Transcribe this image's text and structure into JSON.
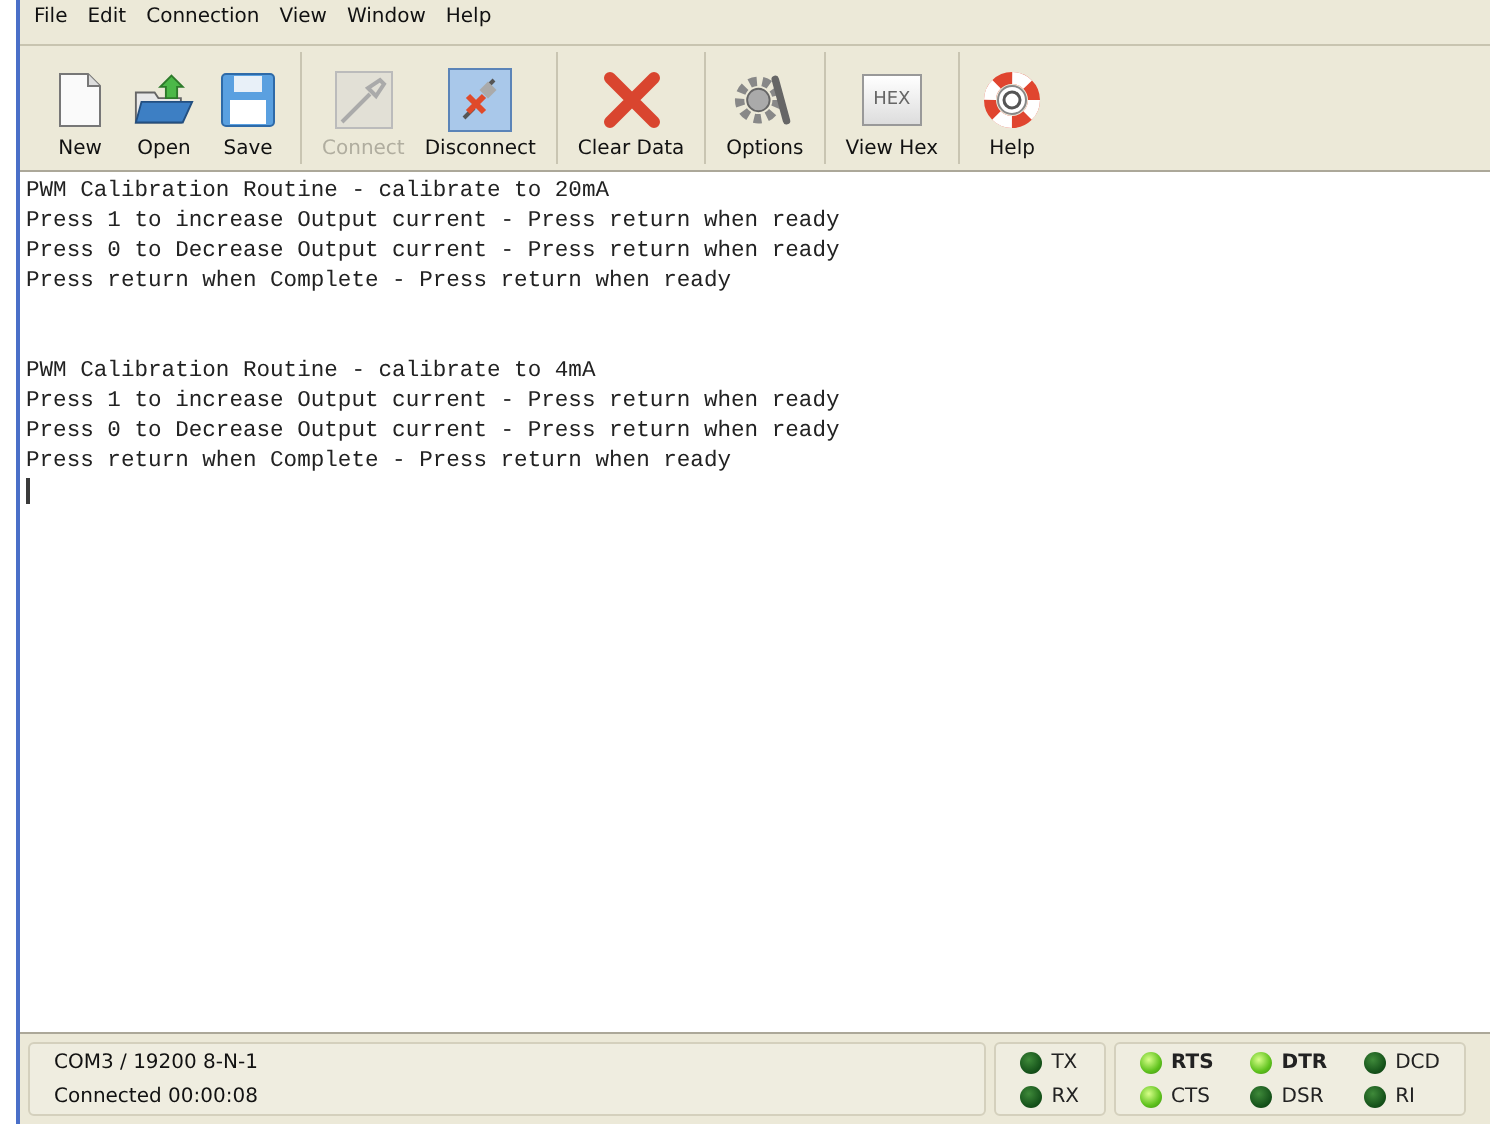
{
  "menu": [
    {
      "label": "File"
    },
    {
      "label": "Edit"
    },
    {
      "label": "Connection"
    },
    {
      "label": "View"
    },
    {
      "label": "Window"
    },
    {
      "label": "Help"
    }
  ],
  "toolbar": {
    "groups": [
      [
        {
          "label": "New",
          "kind": "new",
          "disabled": false,
          "pressed": false
        },
        {
          "label": "Open",
          "kind": "open",
          "disabled": false,
          "pressed": false
        },
        {
          "label": "Save",
          "kind": "save",
          "disabled": false,
          "pressed": false
        }
      ],
      [
        {
          "label": "Connect",
          "kind": "connect",
          "disabled": true,
          "pressed": false
        },
        {
          "label": "Disconnect",
          "kind": "disconnect",
          "disabled": false,
          "pressed": true
        }
      ],
      [
        {
          "label": "Clear Data",
          "kind": "clear",
          "disabled": false,
          "pressed": false
        }
      ],
      [
        {
          "label": "Options",
          "kind": "options",
          "disabled": false,
          "pressed": false
        }
      ],
      [
        {
          "label": "View Hex",
          "kind": "hex",
          "disabled": false,
          "pressed": false,
          "icon_text": "HEX"
        }
      ],
      [
        {
          "label": "Help",
          "kind": "help",
          "disabled": false,
          "pressed": false
        }
      ]
    ]
  },
  "terminal": {
    "blocks": [
      [
        "PWM Calibration Routine - calibrate to 20mA",
        "Press 1 to increase Output current - Press return when ready",
        "Press 0 to Decrease Output current - Press return when ready",
        "Press return when Complete - Press return when ready"
      ],
      [
        "PWM Calibration Routine - calibrate to 4mA",
        "Press 1 to increase Output current - Press return when ready",
        "Press 0 to Decrease Output current - Press return when ready",
        "Press return when Complete - Press return when ready"
      ]
    ]
  },
  "status_bar": {
    "port": "COM3 / 19200 8-N-1",
    "connection": "Connected 00:00:08",
    "data_leds": [
      {
        "label": "TX",
        "on": false
      },
      {
        "label": "RX",
        "on": false
      }
    ],
    "signal_leds": [
      {
        "label": "RTS",
        "on": true,
        "bold": true
      },
      {
        "label": "DTR",
        "on": true,
        "bold": true
      },
      {
        "label": "DCD",
        "on": false,
        "bold": false
      },
      {
        "label": "CTS",
        "on": true,
        "bold": false
      },
      {
        "label": "DSR",
        "on": false,
        "bold": false
      },
      {
        "label": "RI",
        "on": false,
        "bold": false
      }
    ]
  }
}
